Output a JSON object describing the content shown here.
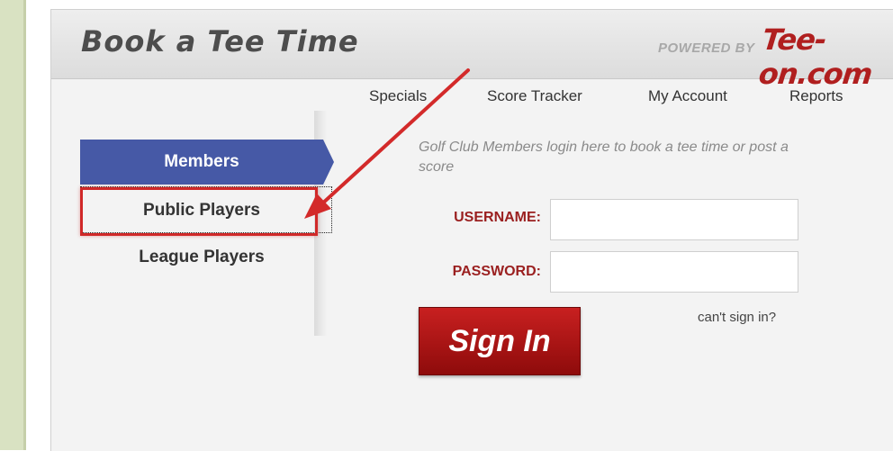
{
  "header": {
    "title": "Book a Tee Time",
    "powered_by": "POWERED BY",
    "logo_text": "Tee-on.com"
  },
  "nav": {
    "items": [
      {
        "label": "Specials"
      },
      {
        "label": "Score Tracker"
      },
      {
        "label": "My Account"
      },
      {
        "label": "Reports"
      }
    ]
  },
  "sidebar": {
    "items": [
      {
        "label": "Members",
        "active": true
      },
      {
        "label": "Public Players",
        "active": false,
        "highlighted": true
      },
      {
        "label": "League Players",
        "active": false
      }
    ]
  },
  "login": {
    "intro": "Golf Club Members login here to book a tee time or post a score",
    "username_label": "USERNAME:",
    "password_label": "PASSWORD:",
    "username_value": "",
    "password_value": "",
    "sign_in_label": "Sign In",
    "cant_sign_in": "can't sign in?"
  },
  "colors": {
    "accent_blue": "#4659a6",
    "brand_red": "#b01f1f",
    "annotation_red": "#d02828"
  }
}
